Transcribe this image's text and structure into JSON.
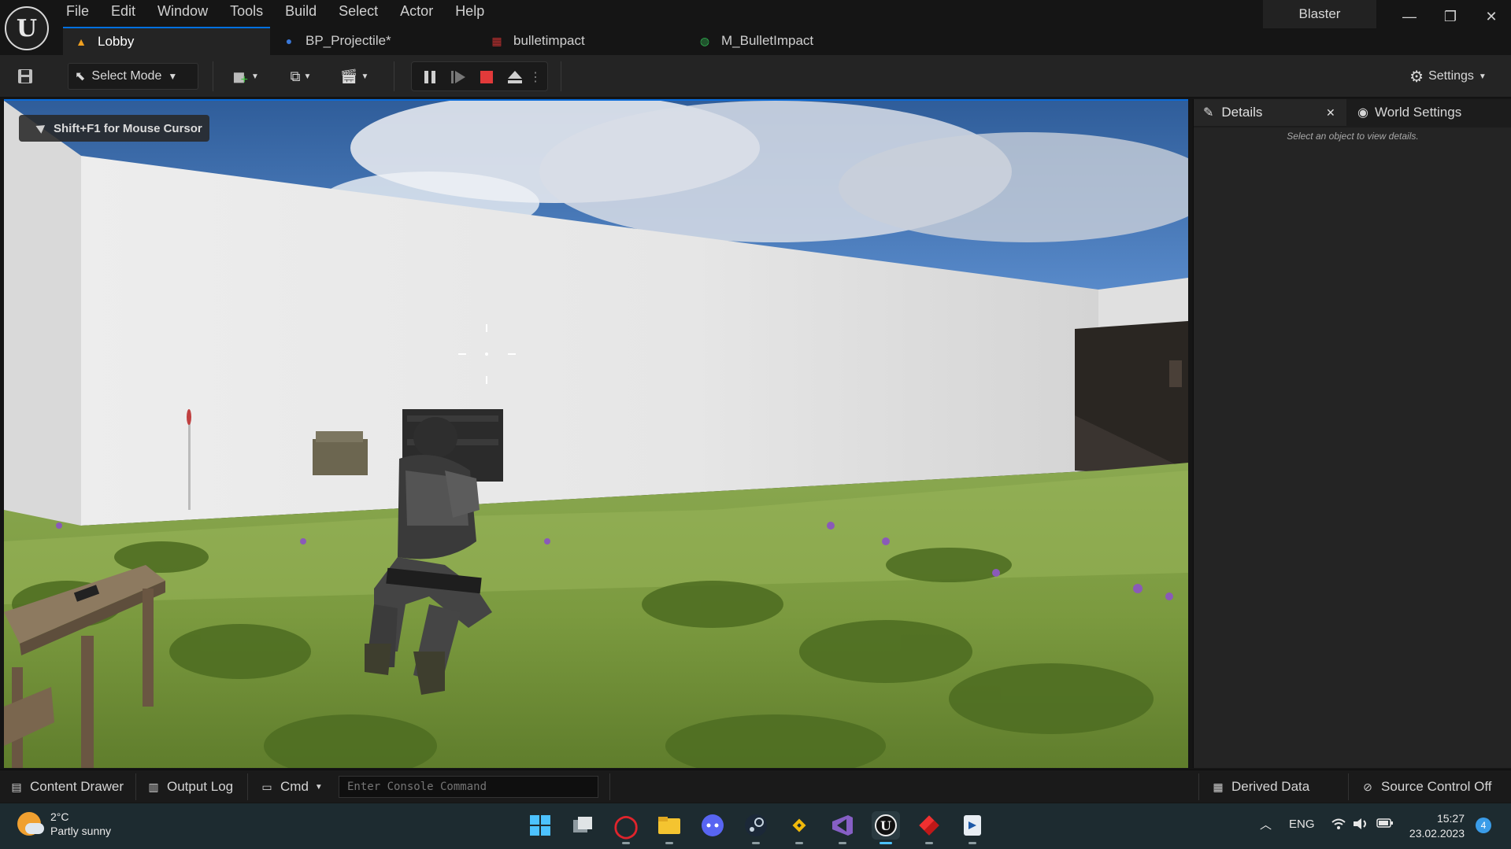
{
  "app": {
    "menu": [
      "File",
      "Edit",
      "Window",
      "Tools",
      "Build",
      "Select",
      "Actor",
      "Help"
    ],
    "project_name": "Blaster",
    "tabs": [
      {
        "label": "Lobby",
        "icon": "level-icon",
        "active": true
      },
      {
        "label": "BP_Projectile*",
        "icon": "blueprint-icon",
        "active": false
      },
      {
        "label": "bulletimpact",
        "icon": "particle-icon",
        "active": false
      },
      {
        "label": "M_BulletImpact",
        "icon": "material-icon",
        "active": false
      }
    ],
    "window_controls": [
      "minimize",
      "restore",
      "close"
    ]
  },
  "toolbar": {
    "select_mode_label": "Select Mode",
    "settings_label": "Settings",
    "play_controls": [
      "pause",
      "advance-frame",
      "stop",
      "eject"
    ]
  },
  "viewport": {
    "hint": "Shift+F1 for Mouse Cursor"
  },
  "right_panel": {
    "details_tab": "Details",
    "world_settings_tab": "World Settings",
    "empty_message": "Select an object to view details."
  },
  "statusbar": {
    "content_drawer": "Content Drawer",
    "output_log": "Output Log",
    "cmd_label": "Cmd",
    "console_placeholder": "Enter Console Command",
    "derived_data": "Derived Data",
    "source_control": "Source Control Off"
  },
  "taskbar": {
    "weather_temp": "2°C",
    "weather_desc": "Partly sunny",
    "language": "ENG",
    "time": "15:27",
    "date": "23.02.2023",
    "notification_count": "4",
    "apps": [
      "windows-start",
      "task-view",
      "opera",
      "file-explorer",
      "discord",
      "steam",
      "binance",
      "visual-studio",
      "unreal-engine",
      "git-tool",
      "epic-tool"
    ]
  }
}
